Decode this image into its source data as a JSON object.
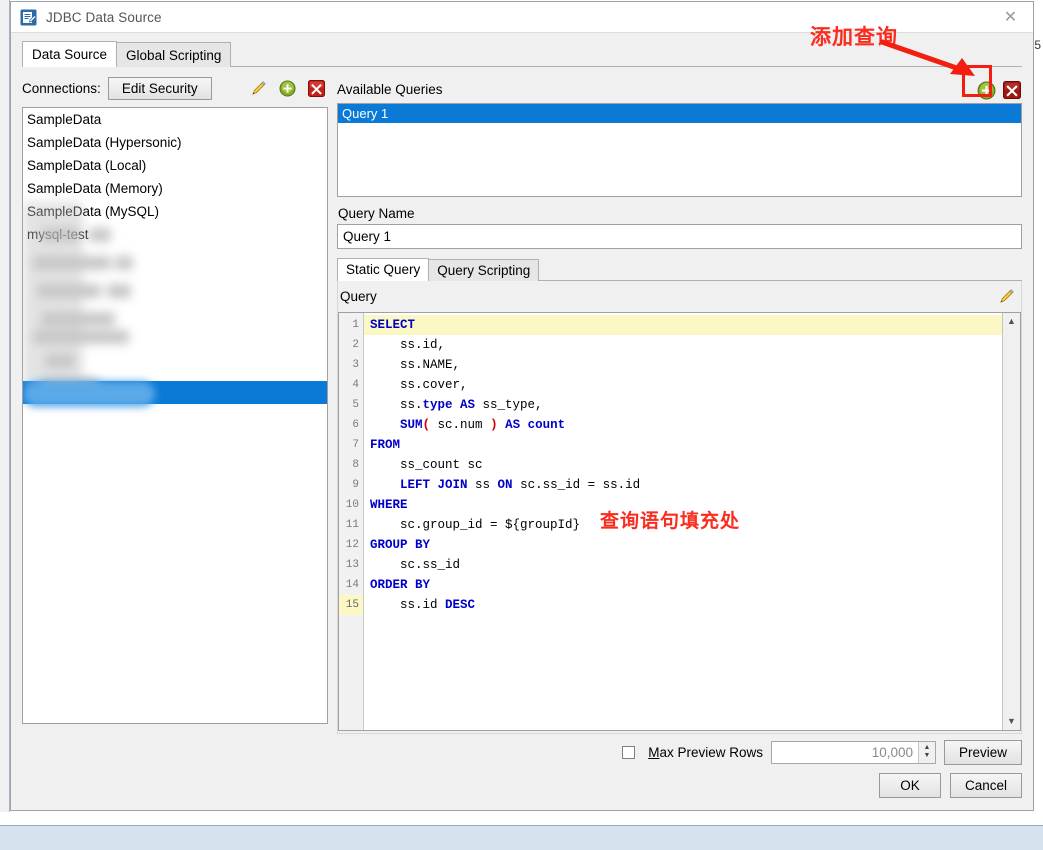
{
  "window": {
    "title": "JDBC Data Source",
    "icon": "jdbc-datasource-icon",
    "close_label": "✕"
  },
  "behind": {
    "partial_text": "5"
  },
  "tabs": [
    {
      "label": "Data Source",
      "active": true
    },
    {
      "label": "Global Scripting",
      "active": false
    }
  ],
  "left_pane": {
    "connections_label": "Connections:",
    "edit_security_button": "Edit Security",
    "icons": [
      {
        "name": "edit-pencil-icon",
        "title": "Edit"
      },
      {
        "name": "add-plus-icon",
        "title": "Add"
      },
      {
        "name": "delete-x-icon",
        "title": "Delete"
      }
    ],
    "connections": [
      {
        "label": "SampleData",
        "selected": false
      },
      {
        "label": "SampleData (Hypersonic)",
        "selected": false
      },
      {
        "label": "SampleData (Local)",
        "selected": false
      },
      {
        "label": "SampleData (Memory)",
        "selected": false
      },
      {
        "label": "SampleData (MySQL)",
        "selected": false
      },
      {
        "label": "mysql-test",
        "selected": false
      }
    ]
  },
  "right_pane": {
    "available_queries_label": "Available Queries",
    "icons": [
      {
        "name": "add-query-icon",
        "title": "Add Query"
      },
      {
        "name": "delete-query-icon",
        "title": "Delete Query"
      }
    ],
    "queries": [
      {
        "label": "Query 1",
        "selected": true
      }
    ],
    "query_name_label": "Query Name",
    "query_name_value": "Query 1",
    "sub_tabs": [
      {
        "label": "Static Query",
        "active": true
      },
      {
        "label": "Query Scripting",
        "active": false
      }
    ],
    "query_section_label": "Query",
    "query_edit_icon": "edit-pencil-icon"
  },
  "editor": {
    "current_line": 15,
    "line_numbers": [
      "1",
      "2",
      "3",
      "4",
      "5",
      "6",
      "7",
      "8",
      "9",
      "10",
      "11",
      "12",
      "13",
      "14",
      "15"
    ],
    "lines": [
      {
        "n": 1,
        "indent": 0,
        "tokens": [
          {
            "t": "SELECT",
            "k": "kw"
          }
        ]
      },
      {
        "n": 2,
        "indent": 1,
        "tokens": [
          {
            "t": "ss.id,",
            "k": "pl"
          }
        ]
      },
      {
        "n": 3,
        "indent": 1,
        "tokens": [
          {
            "t": "ss.NAME,",
            "k": "pl"
          }
        ]
      },
      {
        "n": 4,
        "indent": 1,
        "tokens": [
          {
            "t": "ss.cover,",
            "k": "pl"
          }
        ]
      },
      {
        "n": 5,
        "indent": 1,
        "tokens": [
          {
            "t": "ss.",
            "k": "pl"
          },
          {
            "t": "type AS",
            "k": "kw"
          },
          {
            "t": " ss_type,",
            "k": "pl"
          }
        ]
      },
      {
        "n": 6,
        "indent": 1,
        "tokens": [
          {
            "t": "SUM",
            "k": "kw"
          },
          {
            "t": "(",
            "k": "paren"
          },
          {
            "t": " sc.num ",
            "k": "pl"
          },
          {
            "t": ")",
            "k": "paren"
          },
          {
            "t": " AS count",
            "k": "kw"
          }
        ]
      },
      {
        "n": 7,
        "indent": 0,
        "tokens": [
          {
            "t": "FROM",
            "k": "kw"
          }
        ]
      },
      {
        "n": 8,
        "indent": 1,
        "tokens": [
          {
            "t": "ss_count sc",
            "k": "pl"
          }
        ]
      },
      {
        "n": 9,
        "indent": 1,
        "tokens": [
          {
            "t": "LEFT JOIN",
            "k": "kw"
          },
          {
            "t": " ss ",
            "k": "pl"
          },
          {
            "t": "ON",
            "k": "kw"
          },
          {
            "t": " sc.ss_id = ss.id",
            "k": "pl"
          }
        ]
      },
      {
        "n": 10,
        "indent": 0,
        "tokens": [
          {
            "t": "WHERE",
            "k": "kw"
          }
        ]
      },
      {
        "n": 11,
        "indent": 1,
        "tokens": [
          {
            "t": "sc.group_id = ${groupId}",
            "k": "pl"
          }
        ]
      },
      {
        "n": 12,
        "indent": 0,
        "tokens": [
          {
            "t": "GROUP BY",
            "k": "kw"
          }
        ]
      },
      {
        "n": 13,
        "indent": 1,
        "tokens": [
          {
            "t": "sc.ss_id",
            "k": "pl"
          }
        ]
      },
      {
        "n": 14,
        "indent": 0,
        "tokens": [
          {
            "t": "ORDER BY",
            "k": "kw"
          }
        ]
      },
      {
        "n": 15,
        "indent": 1,
        "tokens": [
          {
            "t": "ss.id ",
            "k": "pl"
          },
          {
            "t": "DESC",
            "k": "kw"
          }
        ]
      }
    ],
    "scroll_up": "▲",
    "scroll_down": "▼"
  },
  "footer": {
    "max_preview_rows_label_prefix": "M",
    "max_preview_rows_label_rest": "ax Preview Rows",
    "max_preview_rows_checked": false,
    "max_preview_rows_value": "10,000",
    "spinner_up": "▲",
    "spinner_down": "▼",
    "preview_button": "Preview",
    "ok_button": "OK",
    "cancel_button": "Cancel"
  },
  "annotations": [
    {
      "name": "add-query-annotation",
      "text": "添加查询",
      "color": "#fb2b1e"
    },
    {
      "name": "query-fill-annotation",
      "text": "查询语句填充处",
      "color": "#fb2b1e"
    }
  ],
  "colors": {
    "selection_blue": "#0b7ad6",
    "annotation_red": "#fb2b1e",
    "keyword_blue": "#0000c8",
    "paren_red": "#d00000",
    "current_line_yellow": "#fbf8c6",
    "dialog_gray": "#f0f0f0"
  }
}
